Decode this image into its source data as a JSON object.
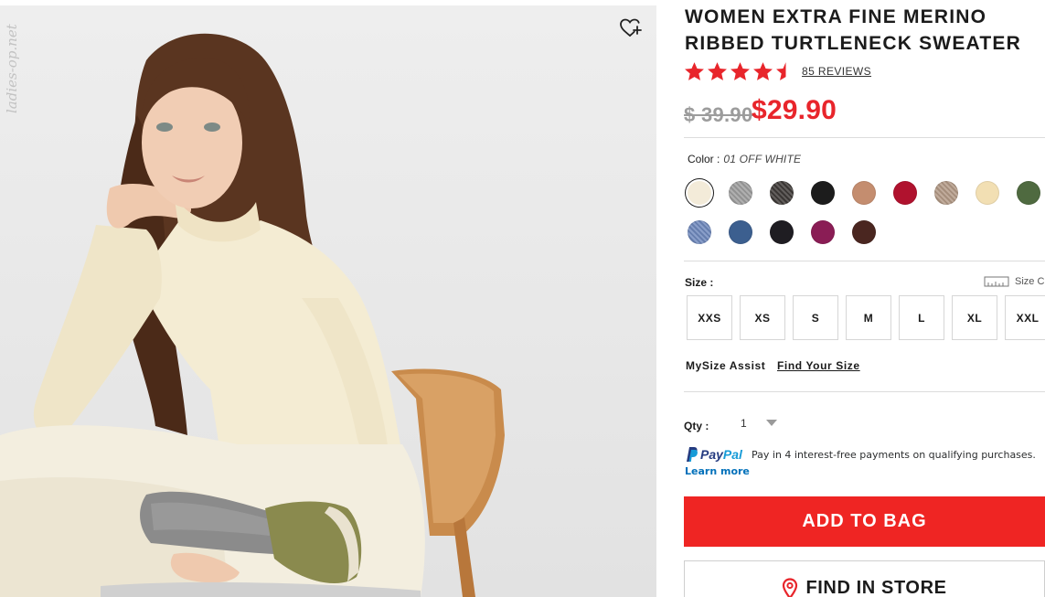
{
  "photo": {
    "watermark": "ladies-op.net",
    "wishlist_icon": "heart-plus-icon"
  },
  "product": {
    "title": "WOMEN EXTRA FINE MERINO RIBBED TURTLENECK SWEATER",
    "rating": 4.5,
    "rating_max": 5,
    "reviews_label": "85 REVIEWS",
    "price_original": "$ 39.90",
    "price_sale": "$29.90",
    "accent_color": "#e8252b"
  },
  "color": {
    "label": "Color :",
    "selected_value": "01 OFF WHITE",
    "swatches": [
      {
        "hex": "#f3ebd9",
        "selected": true
      },
      {
        "hex": "#9e9e9e",
        "textured": true
      },
      {
        "hex": "#3f3b38",
        "textured": true
      },
      {
        "hex": "#1c1c1c"
      },
      {
        "hex": "#c48d6f"
      },
      {
        "hex": "#b0122e"
      },
      {
        "hex": "#b39a86",
        "textured": true
      },
      {
        "hex": "#f2dfb3"
      },
      {
        "hex": "#4f6a40"
      },
      {
        "hex": "#6f89bd",
        "textured": true
      },
      {
        "hex": "#3c5f8f"
      },
      {
        "hex": "#1f1d22"
      },
      {
        "hex": "#8a1d55"
      },
      {
        "hex": "#4a2620"
      }
    ]
  },
  "size": {
    "label": "Size :",
    "chart_label": "Size C",
    "options": [
      "XXS",
      "XS",
      "S",
      "M",
      "L",
      "XL",
      "XXL"
    ]
  },
  "mysize": {
    "label": "MySize Assist",
    "link": "Find Your Size"
  },
  "quantity": {
    "label": "Qty :",
    "value": "1"
  },
  "paypal": {
    "brand_pay": "Pay",
    "brand_pal": "Pal",
    "message": "Pay in 4 interest-free payments on qualifying purchases.",
    "learn_more": "Learn more"
  },
  "actions": {
    "add_to_bag": "ADD TO BAG",
    "find_in_store": "FIND IN STORE"
  }
}
